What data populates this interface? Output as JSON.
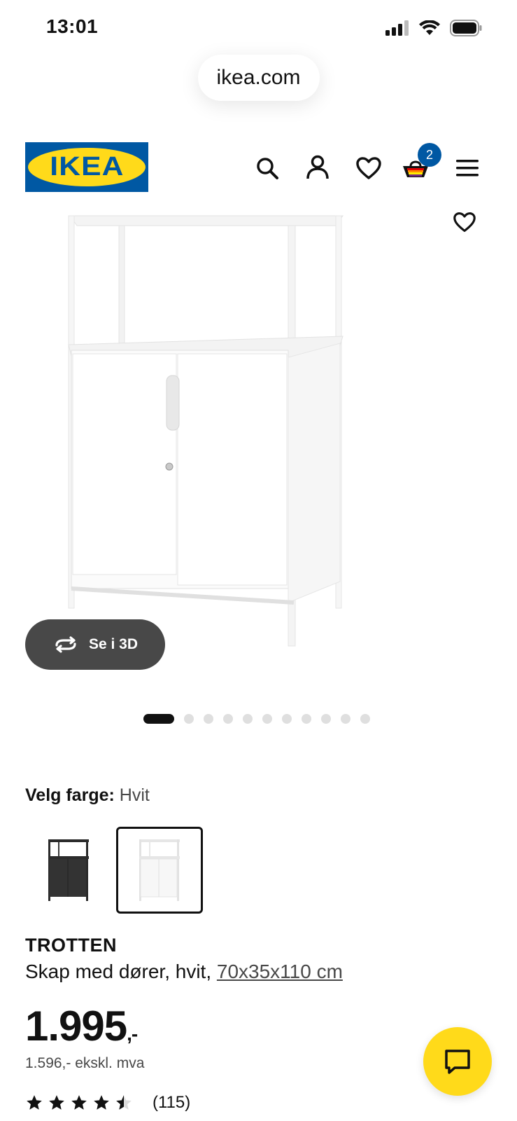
{
  "status": {
    "time": "13:01"
  },
  "browser": {
    "url": "ikea.com"
  },
  "header": {
    "logo_text": "IKEA",
    "cart_count": "2"
  },
  "gallery": {
    "view_3d_label": "Se i 3D",
    "dots_total": 11,
    "active_index": 0
  },
  "color": {
    "label": "Velg farge:",
    "value": "Hvit"
  },
  "product": {
    "name": "TROTTEN",
    "description": "Skap med dører, hvit, ",
    "dimensions": "70x35x110 cm",
    "price_main": "1.995",
    "price_suffix": ",-",
    "price_ex_vat": "1.596,- ekskl. mva",
    "rating": 4.5,
    "review_count": "(115)"
  },
  "colors": {
    "brand_blue": "#0058a3",
    "brand_yellow": "#ffda1a"
  }
}
